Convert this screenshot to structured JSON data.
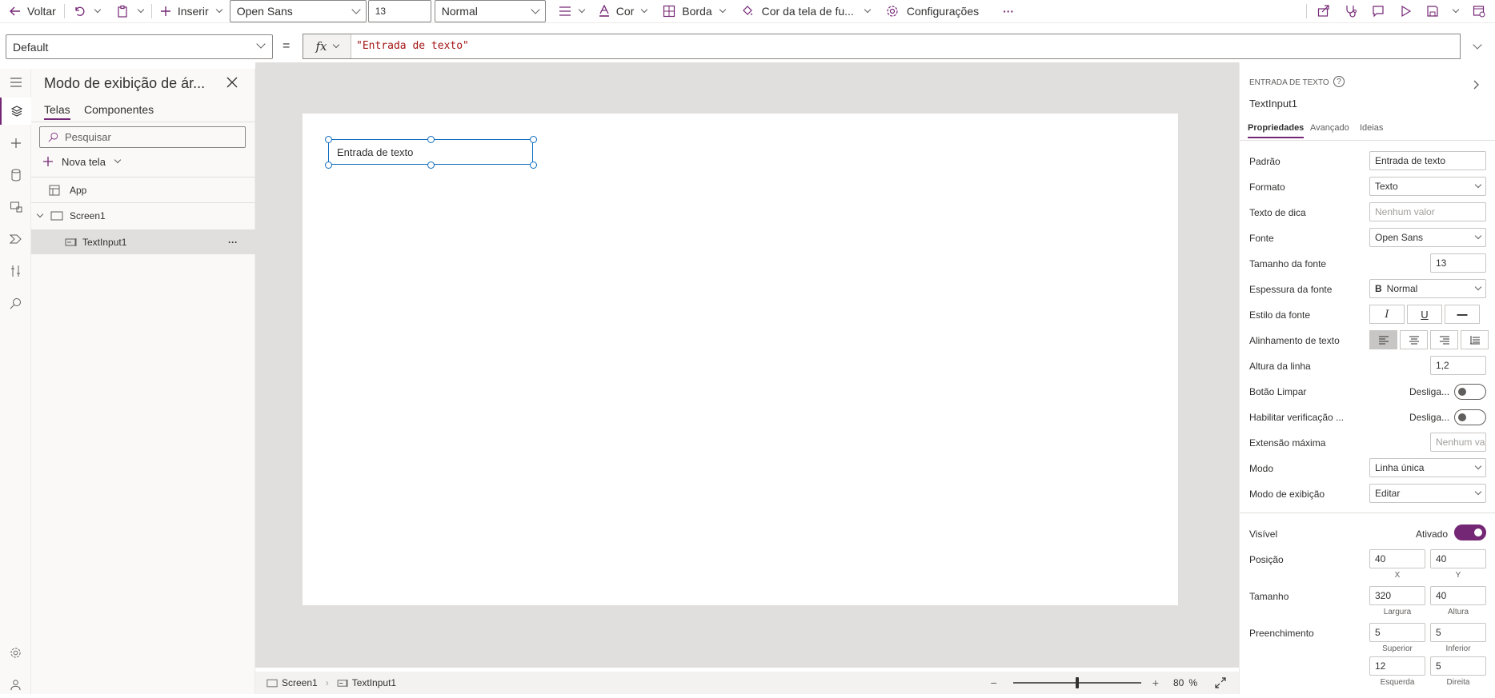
{
  "toolbar": {
    "back_label": "Voltar",
    "insert_label": "Inserir",
    "font_value": "Open Sans",
    "font_size_value": "13",
    "font_weight_value": "Normal",
    "color_label": "Cor",
    "border_label": "Borda",
    "fill_label": "Cor da tela de fu...",
    "settings_label": "Configurações",
    "more_label": "···"
  },
  "formula": {
    "property": "Default",
    "equals": "=",
    "fx": "fx",
    "value": "\"Entrada de texto\""
  },
  "tree": {
    "title": "Modo de exibição de ár...",
    "tab_screens": "Telas",
    "tab_components": "Componentes",
    "search_placeholder": "Pesquisar",
    "new_screen": "Nova tela",
    "items": [
      {
        "label": "App"
      },
      {
        "label": "Screen1"
      },
      {
        "label": "TextInput1",
        "more": "···"
      }
    ]
  },
  "canvas": {
    "textinput_text": "Entrada de texto"
  },
  "bottom": {
    "crumb_screen": "Screen1",
    "crumb_control": "TextInput1",
    "zoom_minus": "−",
    "zoom_plus": "+",
    "zoom_value": "80",
    "zoom_unit": "%",
    "zoom_level": 0.5
  },
  "panel": {
    "type_label": "ENTRADA DE TEXTO",
    "control_name": "TextInput1",
    "tabs": [
      "Propriedades",
      "Avançado",
      "Ideias"
    ],
    "default_label": "Padrão",
    "default_value": "Entrada de texto",
    "format_label": "Formato",
    "format_value": "Texto",
    "hint_label": "Texto de dica",
    "hint_placeholder": "Nenhum valor",
    "font_label": "Fonte",
    "font_value": "Open Sans",
    "font_size_label": "Tamanho da fonte",
    "font_size_value": "13",
    "font_weight_label": "Espessura da fonte",
    "font_weight_prefix": "B",
    "font_weight_value": "Normal",
    "font_style_label": "Estilo da fonte",
    "font_style_buttons": [
      "I",
      "U",
      "—"
    ],
    "text_align_label": "Alinhamento de texto",
    "line_height_label": "Altura da linha",
    "line_height_value": "1,2",
    "clear_button_label": "Botão Limpar",
    "clear_button_state": "Desliga...",
    "spellcheck_label": "Habilitar verificação ...",
    "spellcheck_state": "Desliga...",
    "max_length_label": "Extensão máxima",
    "max_length_placeholder": "Nenhum val",
    "mode_label": "Modo",
    "mode_value": "Linha única",
    "display_mode_label": "Modo de exibição",
    "display_mode_value": "Editar",
    "visible_label": "Visível",
    "visible_state": "Ativado",
    "position_label": "Posição",
    "position_x": "40",
    "position_y": "40",
    "x_label": "X",
    "y_label": "Y",
    "size_label": "Tamanho",
    "width_value": "320",
    "height_value": "40",
    "width_label": "Largura",
    "height_label": "Altura",
    "padding_label": "Preenchimento",
    "padding_top": "5",
    "padding_bottom": "5",
    "padding_left": "12",
    "padding_right": "5",
    "top_label": "Superior",
    "bottom_label": "Inferior",
    "left_label": "Esquerda",
    "right_label": "Direita"
  },
  "colors": {
    "accent": "#742774",
    "selection": "#0f6cbd",
    "canvas_bg": "#e1dfdd",
    "formula_string": "#a31515"
  }
}
